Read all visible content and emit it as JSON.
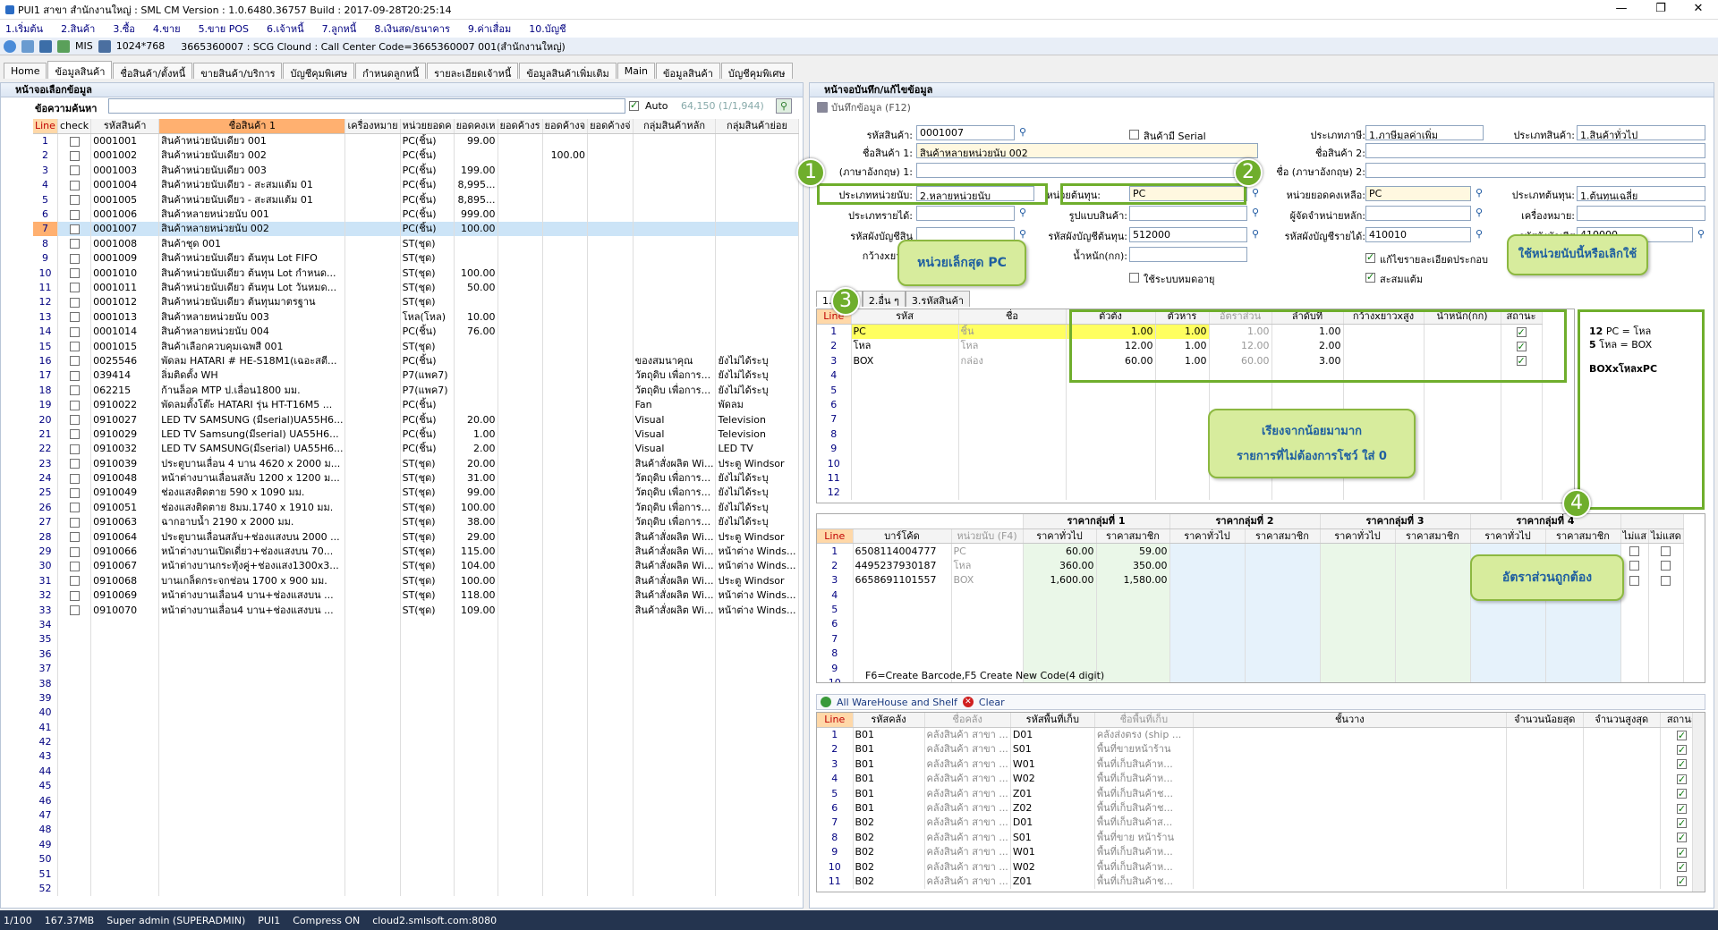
{
  "window": {
    "title": "PUI1 สาขา สำนักงานใหญ่ : SML CM Version : 1.0.6480.36757  Build : 2017-09-28T20:25:14"
  },
  "menu": [
    "1.เริ่มต้น",
    "2.สินค้า",
    "3.ซื้อ",
    "4.ขาย",
    "5.ขาย POS",
    "6.เจ้าหนี้",
    "7.ลูกหนี้",
    "8.เงินสด/ธนาคาร",
    "9.ค่าเสื่อม",
    "10.บัญชี"
  ],
  "toolbar": {
    "mis": "MIS",
    "resolution": "1024*768",
    "info": "3665360007 : SCG Clound : Call Center Code=3665360007 001(สำนักงานใหญ่)"
  },
  "tabs": [
    "Home",
    "ข้อมูลสินค้า",
    "ชื่อสินค้า/ตั้งหนี้",
    "ขายสินค้า/บริการ",
    "บัญชีคุมพิเศษ",
    "กำหนดลูกหนี้",
    "รายละเอียดเจ้าหนี้",
    "ข้อมูลสินค้าเพิ่มเติม",
    "Main",
    "ข้อมูลสินค้า",
    "บัญชีคุมพิเศษ"
  ],
  "left": {
    "header": "หน้าจอเลือกข้อมูล",
    "search_label": "ข้อความค้นหา",
    "auto_label": "Auto",
    "count": "64,150 (1/1,944)",
    "columns": [
      "Line",
      "check",
      "รหัสสินค้า",
      "ชื่อสินค้า 1",
      "เครื่องหมาย",
      "หน่วยยอดค",
      "ยอดคงเห",
      "ยอดค้างร",
      "ยอดค้างจ",
      "ยอดค้างจ่",
      "กลุ่มสินค้าหลัก",
      "กลุ่มสินค้าย่อย"
    ],
    "rows": [
      [
        "1",
        "0001001",
        "สินค้าหน่วยนับเดียว 001",
        "PC(ชิ้น)",
        "99.00",
        "",
        "",
        "",
        ""
      ],
      [
        "2",
        "0001002",
        "สินค้าหน่วยนับเดียว 002",
        "PC(ชิ้น)",
        "",
        "",
        "100.00",
        "",
        ""
      ],
      [
        "3",
        "0001003",
        "สินค้าหน่วยนับเดียว 003",
        "PC(ชิ้น)",
        "199.00",
        "",
        "",
        "",
        ""
      ],
      [
        "4",
        "0001004",
        "สินค้าหน่วยนับเดียว - สะสมแต้ม 01",
        "PC(ชิ้น)",
        "8,995...",
        "",
        "",
        "",
        ""
      ],
      [
        "5",
        "0001005",
        "สินค้าหน่วยนับเดียว - สะสมแต้ม 01",
        "PC(ชิ้น)",
        "8,895...",
        "",
        "",
        "",
        ""
      ],
      [
        "6",
        "0001006",
        "สินค้าหลายหน่วยนับ 001",
        "PC(ชิ้น)",
        "999.00",
        "",
        "",
        "",
        ""
      ],
      [
        "7",
        "0001007",
        "สินค้าหลายหน่วยนับ 002",
        "PC(ชิ้น)",
        "100.00",
        "",
        "",
        "",
        ""
      ],
      [
        "8",
        "0001008",
        "สินค้าชุด 001",
        "ST(ชุด)",
        "",
        "",
        "",
        "",
        ""
      ],
      [
        "9",
        "0001009",
        "สินค้าหน่วยนับเดียว  ต้นทุน Lot FIFO",
        "ST(ชุด)",
        "",
        "",
        "",
        "",
        ""
      ],
      [
        "10",
        "0001010",
        "สินค้าหน่วยนับเดียว  ต้นทุน Lot กำหนด...",
        "ST(ชุด)",
        "100.00",
        "",
        "",
        "",
        ""
      ],
      [
        "11",
        "0001011",
        "สินค้าหน่วยนับเดียว  ต้นทุน Lot วันหมด...",
        "ST(ชุด)",
        "50.00",
        "",
        "",
        "",
        ""
      ],
      [
        "12",
        "0001012",
        "สินค้าหน่วยนับเดียว ต้นทุนมาตรฐาน",
        "ST(ชุด)",
        "",
        "",
        "",
        "",
        ""
      ],
      [
        "13",
        "0001013",
        "สินค้าหลายหน่วยนับ 003",
        "โหล(โหล)",
        "10.00",
        "",
        "",
        "",
        ""
      ],
      [
        "14",
        "0001014",
        "สินค้าหลายหน่วยนับ 004",
        "PC(ชิ้น)",
        "76.00",
        "",
        "",
        "",
        ""
      ],
      [
        "15",
        "0001015",
        "สินค้าเลือกควบคุมเฉพสี 001",
        "ST(ชุด)",
        "",
        "",
        "",
        "",
        ""
      ],
      [
        "16",
        "0025546",
        "พัดลม HATARI # HE-S18M1(เฉอะสตี...",
        "PC(ชิ้น)",
        "",
        "",
        "",
        "ของสมนาคุณ",
        "ยังไม่ได้ระบุ"
      ],
      [
        "17",
        "039414",
        "ลิ่มติดตั้ง WH",
        "P7(แพค7)",
        "",
        "",
        "",
        "วัตถุดิบ เพื่อการ...",
        "ยังไม่ได้ระบุ"
      ],
      [
        "18",
        "062215",
        "ก้านล็อค MTP ป.เลื่อน1800 มม.",
        "P7(แพค7)",
        "",
        "",
        "",
        "วัตถุดิบ เพื่อการ...",
        "ยังไม่ได้ระบุ"
      ],
      [
        "19",
        "0910022",
        "พัดลมตั้งโต๊ะ HATARI รุ่น HT-T16M5 ...",
        "PC(ชิ้น)",
        "",
        "",
        "",
        "Fan",
        "พัดลม"
      ],
      [
        "20",
        "0910027",
        "LED TV SAMSUNG (มีserial)UA55H6...",
        "PC(ชิ้น)",
        "20.00",
        "",
        "",
        "Visual",
        "Television"
      ],
      [
        "21",
        "0910029",
        "LED TV Samsung(มีserial)  UA55H6...",
        "PC(ชิ้น)",
        "1.00",
        "",
        "",
        "Visual",
        "Television"
      ],
      [
        "22",
        "0910032",
        "LED TV SAMSUNG(มีserial)  UA55H6...",
        "PC(ชิ้น)",
        "2.00",
        "",
        "",
        "Visual",
        "LED TV"
      ],
      [
        "23",
        "0910039",
        "ประตูบานเลื่อน 4 บาน 4620 x 2000 ม...",
        "ST(ชุด)",
        "20.00",
        "",
        "",
        "สินค้าสั่งผลิต Wi...",
        "ประตู Windsor"
      ],
      [
        "24",
        "0910048",
        "หน้าต่างบานเลื่อนสลับ  1200 x 1200 ม...",
        "ST(ชุด)",
        "31.00",
        "",
        "",
        "วัตถุดิบ เพื่อการ...",
        "ยังไม่ได้ระบุ"
      ],
      [
        "25",
        "0910049",
        "ช่องแสงติดตาย  590 x 1090 มม.",
        "ST(ชุด)",
        "99.00",
        "",
        "",
        "วัตถุดิบ เพื่อการ...",
        "ยังไม่ได้ระบุ"
      ],
      [
        "26",
        "0910051",
        "ช่องแสงติดตาย 8มม.1740 x 1910 มม.",
        "ST(ชุด)",
        "100.00",
        "",
        "",
        "วัตถุดิบ เพื่อการ...",
        "ยังไม่ได้ระบุ"
      ],
      [
        "27",
        "0910063",
        "ฉากอาบน้ำ 2190 x 2000 มม.",
        "ST(ชุด)",
        "38.00",
        "",
        "",
        "วัตถุดิบ เพื่อการ...",
        "ยังไม่ได้ระบุ"
      ],
      [
        "28",
        "0910064",
        "ประตูบานเลื่อนสลับ+ช่องแสงบน 2000 ...",
        "ST(ชุด)",
        "29.00",
        "",
        "",
        "สินค้าสั่งผลิต Wi...",
        "ประตู Windsor"
      ],
      [
        "29",
        "0910066",
        "หน้าต่างบานเปิดเดี่ยว+ช่องแสงบน 70...",
        "ST(ชุด)",
        "115.00",
        "",
        "",
        "สินค้าสั่งผลิต Wi...",
        "หน้าต่าง Winds..."
      ],
      [
        "30",
        "0910067",
        "หน้าต่างบานกระทุ้งคู่+ช่องแสง1300x3...",
        "ST(ชุด)",
        "104.00",
        "",
        "",
        "สินค้าสั่งผลิต Wi...",
        "หน้าต่าง Winds..."
      ],
      [
        "31",
        "0910068",
        "บานเกล็ดกระจกช่อน  1700 x 900 มม.",
        "ST(ชุด)",
        "100.00",
        "",
        "",
        "สินค้าสั่งผลิต Wi...",
        "ประตู Windsor"
      ],
      [
        "32",
        "0910069",
        "หน้าต่างบานเลื่อน4 บาน+ช่องแสงบน ...",
        "ST(ชุด)",
        "118.00",
        "",
        "",
        "สินค้าสั่งผลิต Wi...",
        "หน้าต่าง Winds..."
      ],
      [
        "33",
        "0910070",
        "หน้าต่างบานเลื่อน4 บาน+ช่องแสงบน ...",
        "ST(ชุด)",
        "109.00",
        "",
        "",
        "สินค้าสั่งผลิต Wi...",
        "หน้าต่าง Winds..."
      ]
    ],
    "empty_lines": [
      "34",
      "35",
      "36",
      "37",
      "38",
      "39",
      "40",
      "41",
      "42",
      "43",
      "44",
      "45",
      "46",
      "47",
      "48",
      "49",
      "50",
      "51",
      "52"
    ]
  },
  "right": {
    "header": "หน้าจอบันทึก/แก้ไขข้อมูล",
    "save_label": "บันทึกข้อมูล (F12)",
    "labels": {
      "code": "รหัสสินค้า:",
      "name1": "ชื่อสินค้า 1:",
      "name_en": "(ภาษาอังกฤษ) 1:",
      "unit_type": "ประเภทหน่วยนับ:",
      "item_type": "ประเภทรายได้:",
      "acc_income": "รหัสผังบัญชีสิน",
      "width": "กว้างxยาวx",
      "serial": "สินค้ามี Serial",
      "tax_type": "ประเภทภาษี:",
      "product_type": "ประเภทสินค้า:",
      "name2": "ชื่อสินค้า 2:",
      "name_en2": "ชื่อ (ภาษาอังกฤษ) 2:",
      "cost_unit": "หน่วยต้นทุน:",
      "product_format": "รูปแบบสินค้า:",
      "acc_cost": "รหัสผังบัญชีต้นทุน:",
      "weight": "น้ำหนัก(กก):",
      "stock_unit": "หน่วยยอดคงเหลือ:",
      "supplier": "ผู้จัดจำหน่ายหลัก:",
      "acc_sale": "รหัสผังบัญชีรายได้:",
      "cost_type": "ประเภทต้นทุน:",
      "brand": "เครื่องหมาย:",
      "acc_x": "รหัสผังบัญชีส",
      "detail_edit": "แก้ไขรายละเอียดประกอบ",
      "points": "สะสมแต้ม",
      "use_system": "ใช้ระบบหมดอายุ"
    },
    "values": {
      "code": "0001007",
      "name1": "สินค้าหลายหน่วยนับ 002",
      "unit_type": "2.หลายหน่วยนับ",
      "tax_type": "1.ภาษีมูลค่าเพิ่ม",
      "product_type": "1.สินค้าทั่วไป",
      "cost_unit": "PC",
      "stock_unit": "PC",
      "cost_type": "1.ต้นทุนเฉลี่ย",
      "acc_cost": "512000",
      "acc_sale": "410010",
      "acc_x": "410000"
    },
    "subtabs": [
      "1.หน่วย",
      "2.อื่น ๆ",
      "3.รหัสสินค้า"
    ],
    "unit_grid": {
      "columns": [
        "Line",
        "รหัส",
        "ชื่อ",
        "ตัวตั้ง",
        "ตัวหาร",
        "อัตราส่วน",
        "ลำดับที่",
        "กว้างxยาวxสูง",
        "น้ำหนัก(กก)",
        "สถานะ"
      ],
      "rows": [
        [
          "1",
          "PC",
          "ชิ้น",
          "1.00",
          "1.00",
          "1.00",
          "1.00"
        ],
        [
          "2",
          "โหล",
          "โหล",
          "12.00",
          "1.00",
          "12.00",
          "2.00"
        ],
        [
          "3",
          "BOX",
          "กล่อง",
          "60.00",
          "1.00",
          "60.00",
          "3.00"
        ]
      ],
      "empty": [
        "4",
        "5",
        "6",
        "7",
        "8",
        "9",
        "10",
        "11",
        "12"
      ]
    },
    "note_box": {
      "l1a": "12",
      "l1b": "PC = โหล",
      "l2a": "5",
      "l2b": "โหล = BOX",
      "l3": "BOXxโหลxPC"
    },
    "barcode_grid": {
      "groups": [
        "ราคากลุ่มที่ 1",
        "ราคากลุ่มที่ 2",
        "ราคากลุ่มที่ 3",
        "ราคากลุ่มที่ 4"
      ],
      "columns": [
        "Line",
        "บาร์โค้ด",
        "หน่วยนับ (F4)",
        "ราคาทั่วไป",
        "ราคาสมาชิก",
        "ราคาทั่วไป",
        "ราคาสมาชิก",
        "ราคาทั่วไป",
        "ราคาสมาชิก",
        "ราคาทั่วไป",
        "ราคาสมาชิก",
        "ไม่แส",
        "ไม่แสด"
      ],
      "rows": [
        [
          "1",
          "6508114004777",
          "PC",
          "60.00",
          "59.00"
        ],
        [
          "2",
          "4495237930187",
          "โหล",
          "360.00",
          "350.00"
        ],
        [
          "3",
          "6658691101557",
          "BOX",
          "1,600.00",
          "1,580.00"
        ]
      ],
      "empty": [
        "4",
        "5",
        "6",
        "7",
        "8",
        "9",
        "10"
      ],
      "footer": "F6=Create Barcode,F5 Create New Code(4 digit)"
    },
    "wh_bar": {
      "all": "All WareHouse and Shelf",
      "clear": "Clear"
    },
    "wh_grid": {
      "columns": [
        "Line",
        "รหัสคลัง",
        "ชื่อคลัง",
        "รหัสพื้นที่เก็บ",
        "ชื่อพื้นที่เก็บ",
        "ชั้นวาง",
        "จำนวนน้อยสุด",
        "จำนวนสูงสุด",
        "สถานะ"
      ],
      "rows": [
        [
          "1",
          "B01",
          "คลังสินค้า สาขา ...",
          "D01",
          "คลังส่งตรง (ship ..."
        ],
        [
          "2",
          "B01",
          "คลังสินค้า สาขา ...",
          "S01",
          "พื้นที่ขายหน้าร้าน"
        ],
        [
          "3",
          "B01",
          "คลังสินค้า สาขา ...",
          "W01",
          "พื้นที่เก็บสินค้าห..."
        ],
        [
          "4",
          "B01",
          "คลังสินค้า สาขา ...",
          "W02",
          "พื้นที่เก็บสินค้าห..."
        ],
        [
          "5",
          "B01",
          "คลังสินค้า สาขา ...",
          "Z01",
          "พื้นที่เก็บสินค้าช..."
        ],
        [
          "6",
          "B01",
          "คลังสินค้า สาขา ...",
          "Z02",
          "พื้นที่เก็บสินค้าช..."
        ],
        [
          "7",
          "B02",
          "คลังสินค้า สาขา ...",
          "D01",
          "พื้นที่เก็บสินค้าส..."
        ],
        [
          "8",
          "B02",
          "คลังสินค้า สาขา ...",
          "S01",
          "พื้นที่ขาย หน้าร้าน"
        ],
        [
          "9",
          "B02",
          "คลังสินค้า สาขา ...",
          "W01",
          "พื้นที่เก็บสินค้าห..."
        ],
        [
          "10",
          "B02",
          "คลังสินค้า สาขา ...",
          "W02",
          "พื้นที่เก็บสินค้าห..."
        ],
        [
          "11",
          "B02",
          "คลังสินค้า สาขา ...",
          "Z01",
          "พื้นที่เก็บสินค้าช..."
        ]
      ]
    }
  },
  "annotations": {
    "b1": "1",
    "b2": "2",
    "b3": "3",
    "b4": "4",
    "c_small": "หน่วยเล็กสุด PC",
    "c_status": "ใช้หน่วยนับนี้หรือเลิกใช้",
    "c_sort1": "เรียงจากน้อยมามาก",
    "c_sort2": "รายการที่ไม่ต้องการโชว์ ใส่ 0",
    "c_ratio": "อัตราส่วนถูกต้อง"
  },
  "status": {
    "page": "1/100",
    "mem": "167.37MB",
    "user": "Super admin (SUPERADMIN)",
    "branch": "PUI1",
    "compress": "Compress ON",
    "server": "cloud2.smlsoft.com:8080"
  }
}
